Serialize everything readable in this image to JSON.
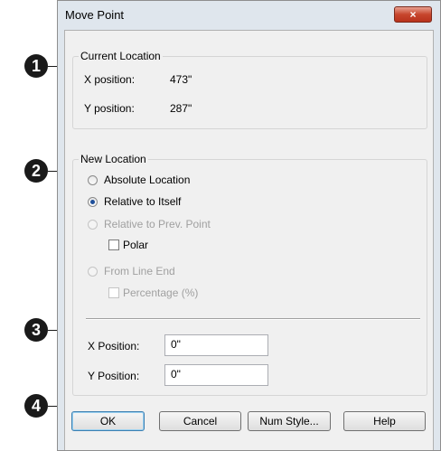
{
  "window": {
    "title": "Move Point",
    "close_label": "×"
  },
  "current_location": {
    "legend": "Current Location",
    "x_label": "X position:",
    "x_value": "473\"",
    "y_label": "Y position:",
    "y_value": "287\""
  },
  "new_location": {
    "legend": "New Location",
    "options": [
      {
        "label": "Absolute Location",
        "checked": false,
        "disabled": false
      },
      {
        "label": "Relative to Itself",
        "checked": true,
        "disabled": false
      },
      {
        "label": "Relative to Prev. Point",
        "checked": false,
        "disabled": true
      },
      {
        "label": "From Line End",
        "checked": false,
        "disabled": true
      }
    ],
    "polar_label": "Polar",
    "percentage_label": "Percentage (%)",
    "x_position_label": "X Position:",
    "x_position_value": "0\"",
    "y_position_label": "Y Position:",
    "y_position_value": "0\""
  },
  "buttons": {
    "ok": "OK",
    "cancel": "Cancel",
    "num_style": "Num Style...",
    "help": "Help"
  },
  "callouts": [
    "1",
    "2",
    "3",
    "4"
  ]
}
